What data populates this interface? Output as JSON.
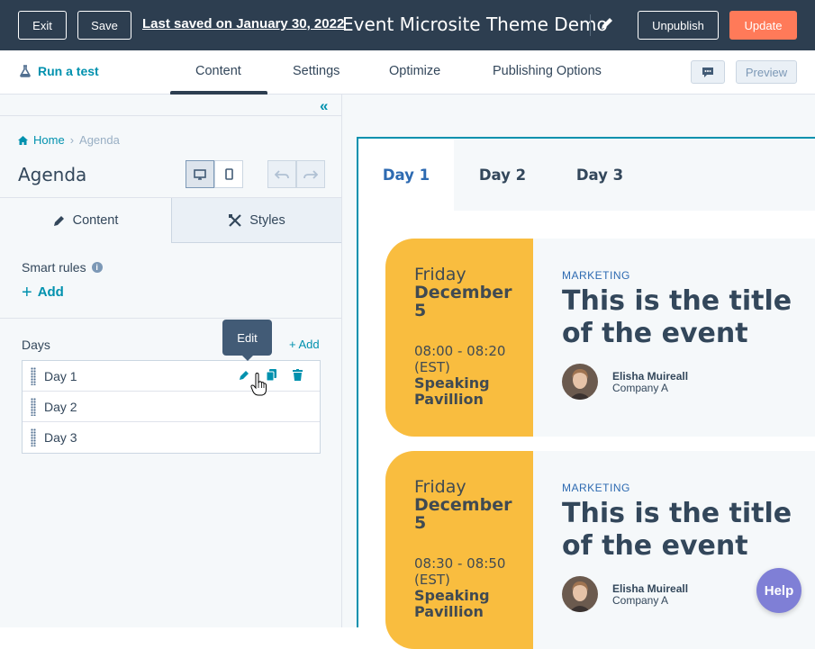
{
  "topbar": {
    "exit_label": "Exit",
    "save_label": "Save",
    "last_saved": "Last saved on January 30, 2022",
    "page_title": "Event Microsite Theme Demo",
    "unpublish_label": "Unpublish",
    "update_label": "Update"
  },
  "nav": {
    "run_test": "Run a test",
    "tabs": [
      "Content",
      "Settings",
      "Optimize",
      "Publishing Options"
    ],
    "active_tab": "Content",
    "preview_label": "Preview"
  },
  "sidebar": {
    "breadcrumb": {
      "home": "Home",
      "current": "Agenda"
    },
    "heading": "Agenda",
    "subtabs": {
      "content": "Content",
      "styles": "Styles"
    },
    "smart_rules_label": "Smart rules",
    "add_rule_label": "Add",
    "days_label": "Days",
    "add_day_label": "+ Add",
    "days": [
      "Day 1",
      "Day 2",
      "Day 3"
    ],
    "tooltip": "Edit"
  },
  "preview": {
    "day_tabs": [
      "Day 1",
      "Day 2",
      "Day 3"
    ],
    "active_day": "Day 1",
    "events": [
      {
        "day_of_week": "Friday",
        "month": "December",
        "day": "5",
        "time": "08:00 - 08:20",
        "tz": "(EST)",
        "location_1": "Speaking",
        "location_2": "Pavillion",
        "category": "MARKETING",
        "title": "This is the title of the event",
        "speaker": "Elisha Muireall",
        "company": "Company A"
      },
      {
        "day_of_week": "Friday",
        "month": "December",
        "day": "5",
        "time": "08:30 - 08:50",
        "tz": "(EST)",
        "location_1": "Speaking",
        "location_2": "Pavillion",
        "category": "MARKETING",
        "title": "This is the title of the event",
        "speaker": "Elisha Muireall",
        "company": "Company A"
      }
    ],
    "help_label": "Help"
  },
  "colors": {
    "topbar": "#2d3e50",
    "accent": "#0091ae",
    "update": "#ff7a59",
    "card_date": "#f9bd3f",
    "help": "#7f7fd6"
  }
}
